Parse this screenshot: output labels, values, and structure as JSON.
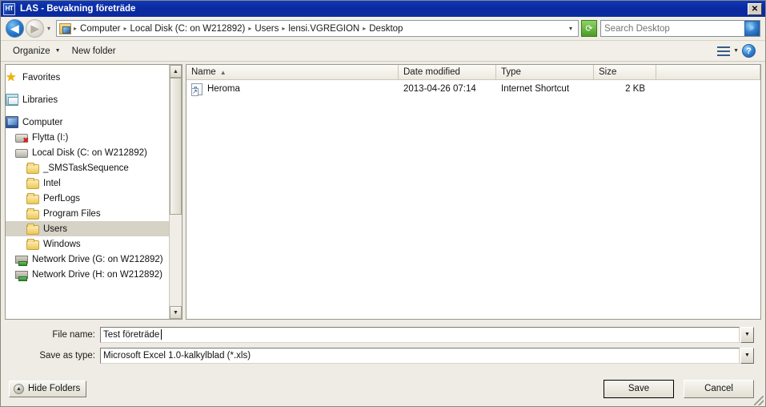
{
  "window": {
    "title": "LAS - Bevakning företräde",
    "icon": "HT",
    "close_label": "✕"
  },
  "address": {
    "back_icon": "◀",
    "forward_icon": "▶",
    "history_dropdown_icon": "▾",
    "folder_icon": "computer-folder-icon",
    "breadcrumbs": [
      {
        "label": "Computer"
      },
      {
        "label": "Local Disk (C: on W212892)"
      },
      {
        "label": "Users"
      },
      {
        "label": "lensi.VGREGION"
      },
      {
        "label": "Desktop"
      }
    ],
    "separator": "▸",
    "dropdown_icon": "▾",
    "refresh_icon": "⟳",
    "search_placeholder": "Search Desktop",
    "search_value": "",
    "search_icon": "⌕"
  },
  "commandbar": {
    "organize_label": "Organize",
    "organize_caret": "▼",
    "new_folder_label": "New folder",
    "view_icon": "list-view-icon",
    "view_caret": "▼",
    "help_label": "?"
  },
  "tree": {
    "items": [
      {
        "label": "Favorites",
        "icon": "favorites-star-icon",
        "indent": 0,
        "selected": false,
        "gap": false
      },
      {
        "label": "Libraries",
        "icon": "libraries-icon",
        "indent": 0,
        "selected": false,
        "gap": true
      },
      {
        "label": "Computer",
        "icon": "computer-icon",
        "indent": 0,
        "selected": false,
        "gap": true
      },
      {
        "label": "Flytta (I:)",
        "icon": "disconnected-drive-icon",
        "indent": 1,
        "selected": false,
        "gap": false
      },
      {
        "label": "Local Disk (C: on W212892)",
        "icon": "drive-icon",
        "indent": 1,
        "selected": false,
        "gap": false
      },
      {
        "label": "_SMSTaskSequence",
        "icon": "folder-icon",
        "indent": 2,
        "selected": false,
        "gap": false
      },
      {
        "label": "Intel",
        "icon": "folder-icon",
        "indent": 2,
        "selected": false,
        "gap": false
      },
      {
        "label": "PerfLogs",
        "icon": "folder-icon",
        "indent": 2,
        "selected": false,
        "gap": false
      },
      {
        "label": "Program Files",
        "icon": "folder-icon",
        "indent": 2,
        "selected": false,
        "gap": false
      },
      {
        "label": "Users",
        "icon": "folder-icon",
        "indent": 2,
        "selected": true,
        "gap": false
      },
      {
        "label": "Windows",
        "icon": "folder-icon",
        "indent": 2,
        "selected": false,
        "gap": false
      },
      {
        "label": "Network Drive (G: on W212892)",
        "icon": "network-drive-icon",
        "indent": 1,
        "selected": false,
        "gap": false
      },
      {
        "label": "Network Drive (H: on W212892)",
        "icon": "network-drive-icon",
        "indent": 1,
        "selected": false,
        "gap": false
      }
    ],
    "scroll_up_icon": "▲",
    "scroll_down_icon": "▼"
  },
  "filelist": {
    "columns": [
      {
        "label": "Name",
        "sort": "▲"
      },
      {
        "label": "Date modified",
        "sort": ""
      },
      {
        "label": "Type",
        "sort": ""
      },
      {
        "label": "Size",
        "sort": ""
      }
    ],
    "rows": [
      {
        "name": "Heroma",
        "date": "2013-04-26 07:14",
        "type": "Internet Shortcut",
        "size": "2 KB",
        "icon": "internet-shortcut-icon"
      }
    ]
  },
  "form": {
    "filename_label": "File name:",
    "filename_value": "Test företräde ",
    "savetype_label": "Save as type:",
    "savetype_value": "Microsoft Excel 1.0-kalkylblad (*.xls)",
    "dropdown_icon": "▼"
  },
  "footer": {
    "hide_folders_label": "Hide Folders",
    "hide_folders_icon": "▲",
    "save_label": "Save",
    "cancel_label": "Cancel"
  },
  "colors": {
    "titlebar": "#0a2aa0",
    "dialog_face": "#eeece4",
    "selection": "#d6d2c6",
    "accent_green": "#4c9c26",
    "accent_blue": "#1a6fc4"
  }
}
